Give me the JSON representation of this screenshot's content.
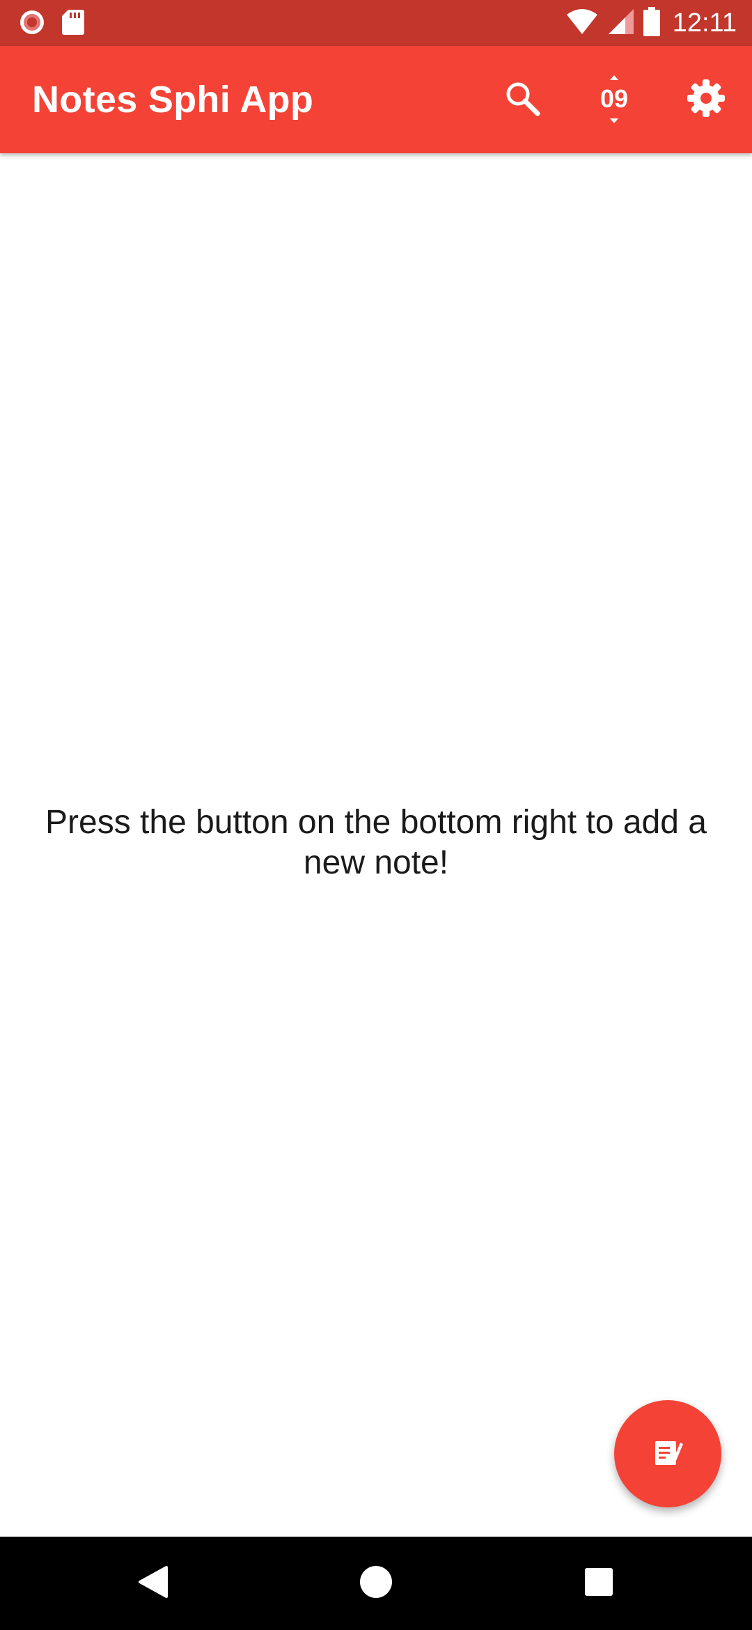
{
  "status_bar": {
    "time": "12:11",
    "background_color": "#c2362c",
    "left_icons": [
      "record-icon",
      "sd-card-icon"
    ],
    "right_icons": [
      "wifi-icon",
      "cell-signal-icon",
      "battery-icon"
    ]
  },
  "app_bar": {
    "title": "Notes Sphi App",
    "background_color": "#f44336",
    "actions": [
      {
        "name": "search-icon"
      },
      {
        "name": "sort-icon",
        "label": "09"
      },
      {
        "name": "settings-icon"
      }
    ]
  },
  "main": {
    "empty_message": "Press the button on the bottom right to add a new note!"
  },
  "fab": {
    "icon": "note-add-icon",
    "color": "#f44336"
  },
  "nav_bar": {
    "buttons": [
      "back-icon",
      "home-icon",
      "recents-icon"
    ]
  }
}
